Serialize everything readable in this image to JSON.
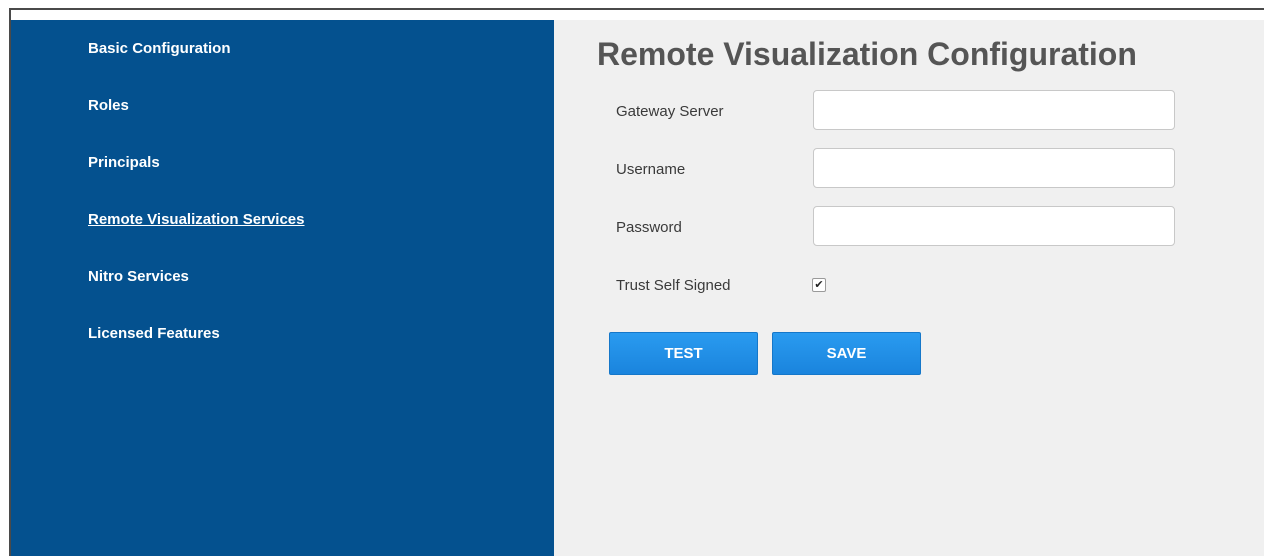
{
  "sidebar": {
    "items": [
      {
        "label": "Basic Configuration"
      },
      {
        "label": "Roles"
      },
      {
        "label": "Principals"
      },
      {
        "label": "Remote Visualization Services",
        "active": true
      },
      {
        "label": "Nitro Services"
      },
      {
        "label": "Licensed Features"
      }
    ]
  },
  "main": {
    "title": "Remote Visualization Configuration",
    "fields": {
      "gateway_server": {
        "label": "Gateway Server",
        "value": ""
      },
      "username": {
        "label": "Username",
        "value": ""
      },
      "password": {
        "label": "Password",
        "value": ""
      },
      "trust_self_signed": {
        "label": "Trust Self Signed",
        "checked": true,
        "glyph": "✔"
      }
    },
    "buttons": {
      "test": "TEST",
      "save": "SAVE"
    }
  },
  "colors": {
    "sidebar_bg": "#04518f",
    "content_bg": "#f0f0f0",
    "button_bg": "#1e8ce6",
    "title_text": "#555555"
  }
}
